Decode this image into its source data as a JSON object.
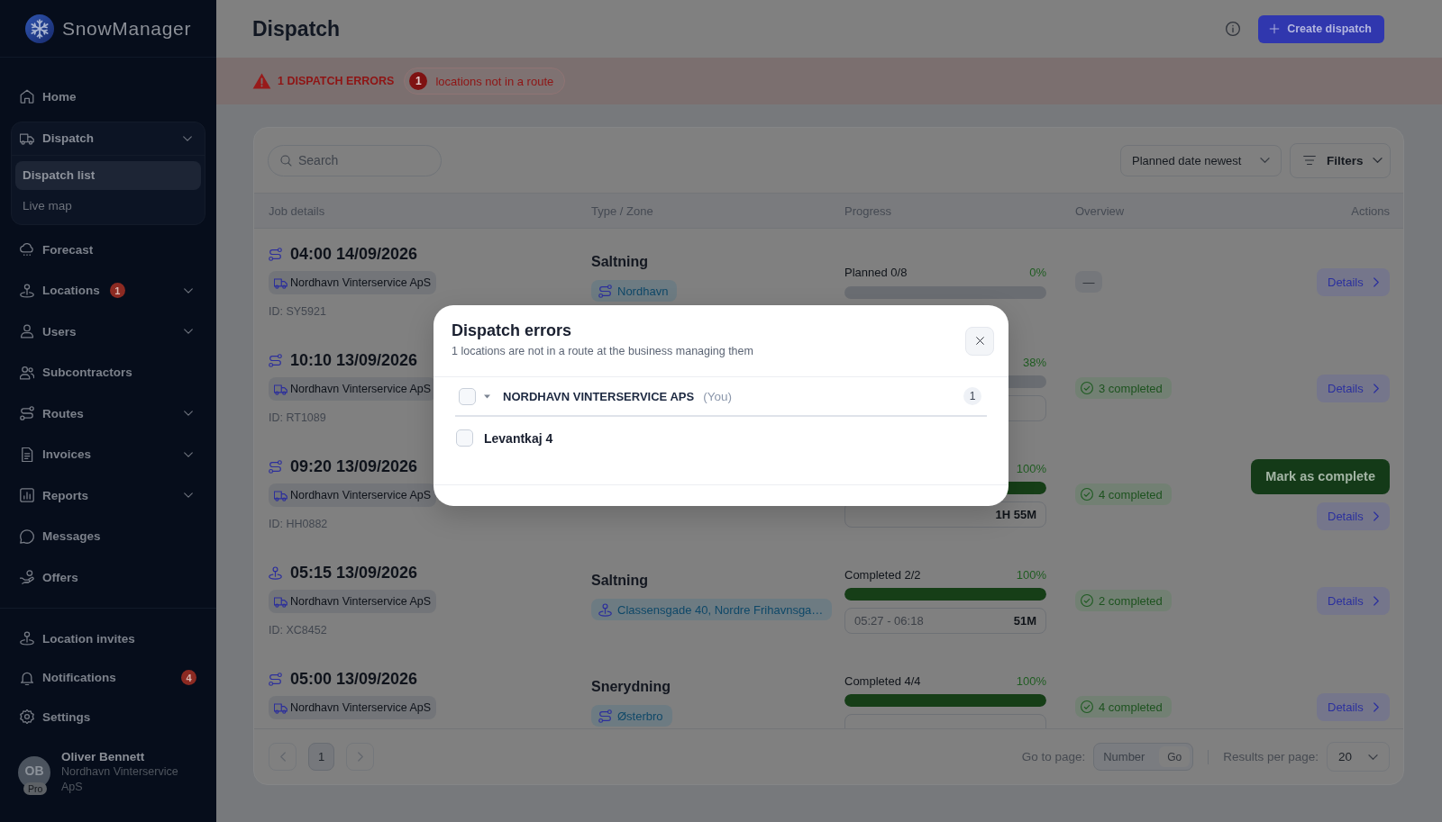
{
  "sidebar": {
    "brand": "SnowManager",
    "items": [
      {
        "label": "Home",
        "selected": false
      },
      {
        "label": "Dispatch",
        "selected": false,
        "expanded": true,
        "children": [
          {
            "label": "Dispatch list",
            "selected": true
          },
          {
            "label": "Live map",
            "selected": false
          }
        ]
      },
      {
        "label": "Forecast",
        "selected": false
      },
      {
        "label": "Locations",
        "selected": false,
        "expanded": false,
        "badge": "1"
      },
      {
        "label": "Users",
        "selected": false,
        "expanded": false
      },
      {
        "label": "Subcontractors",
        "selected": false
      },
      {
        "label": "Routes",
        "selected": false,
        "expanded": false
      },
      {
        "label": "Invoices",
        "selected": false,
        "expanded": false
      },
      {
        "label": "Reports",
        "selected": false,
        "expanded": false
      },
      {
        "label": "Messages",
        "selected": false
      },
      {
        "label": "Offers",
        "selected": false
      }
    ],
    "bottom_items": [
      {
        "label": "Location invites",
        "selected": false
      },
      {
        "label": "Notifications",
        "selected": false,
        "badge": "4"
      },
      {
        "label": "Settings",
        "selected": false
      }
    ],
    "user": {
      "initials": "OB",
      "plan": "Pro",
      "name": "Oliver Bennett",
      "company": "Nordhavn Vinterservice ApS"
    }
  },
  "header": {
    "title": "Dispatch",
    "create_button": "Create dispatch"
  },
  "error_bar": {
    "title": "1 DISPATCH ERRORS",
    "count": "1",
    "label": "locations not in a route"
  },
  "toolbar": {
    "search": {
      "placeholder": "Search"
    },
    "sort": {
      "value": "Planned date newest"
    },
    "filters": "Filters"
  },
  "table": {
    "columns": [
      "Job details",
      "Type / Zone",
      "Progress",
      "Overview",
      "Actions"
    ],
    "rows": [
      {
        "kind": "route",
        "time": "04:00 14/09/2026",
        "company": "Nordhavn Vinterservice ApS",
        "id": "ID: SY5921",
        "type": "Saltning",
        "zone": "Nordhavn",
        "progress": {
          "kind": "planned",
          "label": "Planned 0/8",
          "percent": "0%"
        },
        "overview": {
          "kind": "empty",
          "label": "—"
        },
        "actions": [
          {
            "kind": "details",
            "label": "Details"
          }
        ]
      },
      {
        "kind": "route",
        "time": "10:10 13/09/2026",
        "company": "Nordhavn Vinterservice ApS",
        "id": "ID: RT1089",
        "progress": {
          "kind": "timed",
          "percent": "38%"
        },
        "overview": {
          "kind": "completed",
          "label": "3 completed"
        },
        "actions": [
          {
            "kind": "details",
            "label": "Details"
          }
        ]
      },
      {
        "kind": "route",
        "time": "09:20 13/09/2026",
        "company": "Nordhavn Vinterservice ApS",
        "id": "ID: HH0882",
        "progress": {
          "kind": "timed",
          "percent": "100%",
          "level": 1,
          "duration": "1H 55M"
        },
        "overview": {
          "kind": "completed",
          "label": "4 completed"
        },
        "actions": [
          {
            "kind": "complete",
            "label": "Mark as complete"
          },
          {
            "kind": "details",
            "label": "Details"
          }
        ]
      },
      {
        "kind": "location",
        "time": "05:15 13/09/2026",
        "company": "Nordhavn Vinterservice ApS",
        "id": "ID: XC8452",
        "type": "Saltning",
        "zone": "Classensgade 40, Nordre Frihavnsga…",
        "progress": {
          "kind": "timed",
          "label": "Completed 2/2",
          "percent": "100%",
          "level": 1,
          "range": "05:27 - 06:18",
          "duration": "51M"
        },
        "overview": {
          "kind": "completed",
          "label": "2 completed"
        },
        "actions": [
          {
            "kind": "details",
            "label": "Details"
          }
        ]
      },
      {
        "kind": "route",
        "time": "05:00 13/09/2026",
        "company": "Nordhavn Vinterservice ApS",
        "type": "Snerydning",
        "zone": "Østerbro",
        "progress": {
          "kind": "timed",
          "label": "Completed 4/4",
          "percent": "100%",
          "level": 1
        },
        "overview": {
          "kind": "completed",
          "label": "4 completed"
        },
        "actions": [
          {
            "kind": "details",
            "label": "Details"
          }
        ]
      }
    ]
  },
  "pagination": {
    "previous": {
      "disabled": true
    },
    "pages": [
      {
        "label": "1",
        "selected": true
      }
    ],
    "next": {
      "disabled": true
    },
    "goto_label": "Go to page:",
    "goto_placeholder": "Number",
    "go_button": "Go",
    "per_page_label": "Results per page:",
    "per_page_value": "20"
  },
  "modal": {
    "title": "Dispatch errors",
    "subtitle": "1 locations are not in a route at the business managing them",
    "groups": [
      {
        "name": "NORDHAVN VINTERSERVICE APS",
        "note": "(You)",
        "count": "1",
        "checked": false,
        "expanded": true,
        "items": [
          {
            "label": "Levantkaj 4",
            "checked": false
          }
        ]
      }
    ]
  }
}
